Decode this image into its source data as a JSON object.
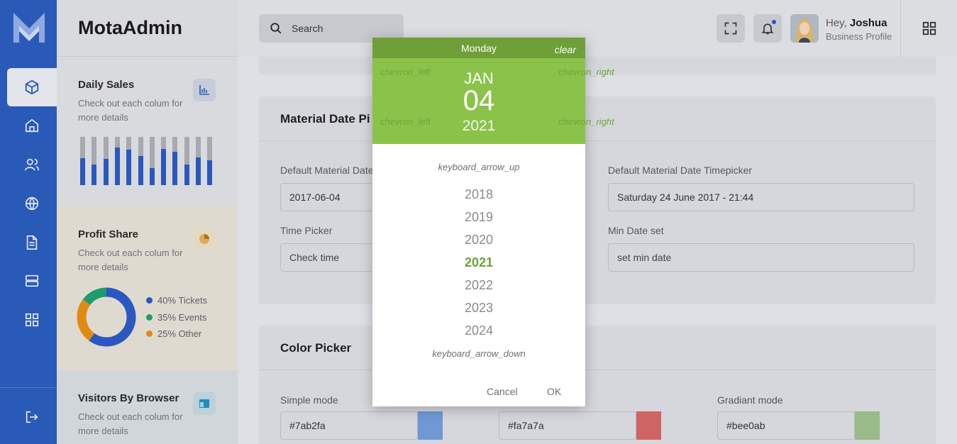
{
  "app": {
    "brand": "MotaAdmin"
  },
  "search": {
    "placeholder": "Search"
  },
  "user": {
    "greeting": "Hey,",
    "name": "Joshua",
    "subtitle": "Business Profile"
  },
  "cards": {
    "daily_sales": {
      "title": "Daily Sales",
      "desc": "Check out each colum for more details",
      "bar_fill": [
        0.56,
        0.42,
        0.55,
        0.78,
        0.74,
        0.61,
        0.36,
        0.75,
        0.69,
        0.43,
        0.57,
        0.51
      ]
    },
    "profit_share": {
      "title": "Profit Share",
      "desc": "Check out each colum for more details",
      "legend": [
        {
          "label": "40% Tickets",
          "color": "#2a58c0"
        },
        {
          "label": "35% Events",
          "color": "#1f9c6d"
        },
        {
          "label": "25% Other",
          "color": "#e08a13"
        }
      ]
    },
    "visitors": {
      "title": "Visitors By Browser",
      "desc": "Check out each colum for more details"
    }
  },
  "sections": {
    "material": {
      "title": "Material Date Pi",
      "default_label": "Default Material Date",
      "default_value": "2017-06-04",
      "timepicker_label": "Default Material Date Timepicker",
      "timepicker_value": "Saturday 24 June 2017 - 21:44",
      "time_label": "Time Picker",
      "time_placeholder": "Check time",
      "min_label": "Min Date set",
      "min_placeholder": "set min date"
    },
    "color": {
      "title": "Color Picker",
      "simple_label": "Simple mode",
      "simple_value": "#7ab2fa",
      "second_value": "#fa7a7a",
      "gradient_label": "Gradiant mode",
      "gradient_value": "#bee0ab",
      "swatches": [
        "#6f98d4",
        "#cf6464",
        "#98bb88"
      ]
    }
  },
  "dialog": {
    "weekday": "Monday",
    "clear": "clear",
    "chevron_left": "chevron_left",
    "chevron_right": "chevron_right",
    "month": "JAN",
    "day": "04",
    "year": "2021",
    "arrow_up": "keyboard_arrow_up",
    "arrow_down": "keyboard_arrow_down",
    "years": [
      "2018",
      "2019",
      "2020",
      "2021",
      "2022",
      "2023",
      "2024"
    ],
    "selected_year": "2021",
    "cancel": "Cancel",
    "ok": "OK",
    "colors": {
      "header": "#6f9f39",
      "date_bg": "#8bc34a"
    }
  },
  "icons": [
    "cube-icon",
    "home-icon",
    "users-icon",
    "globe-icon",
    "document-icon",
    "server-icon",
    "grid-icon",
    "logout-icon",
    "search-icon",
    "fullscreen-icon",
    "bell-icon",
    "apps-icon",
    "chart-icon",
    "pie-icon",
    "browser-icon"
  ]
}
